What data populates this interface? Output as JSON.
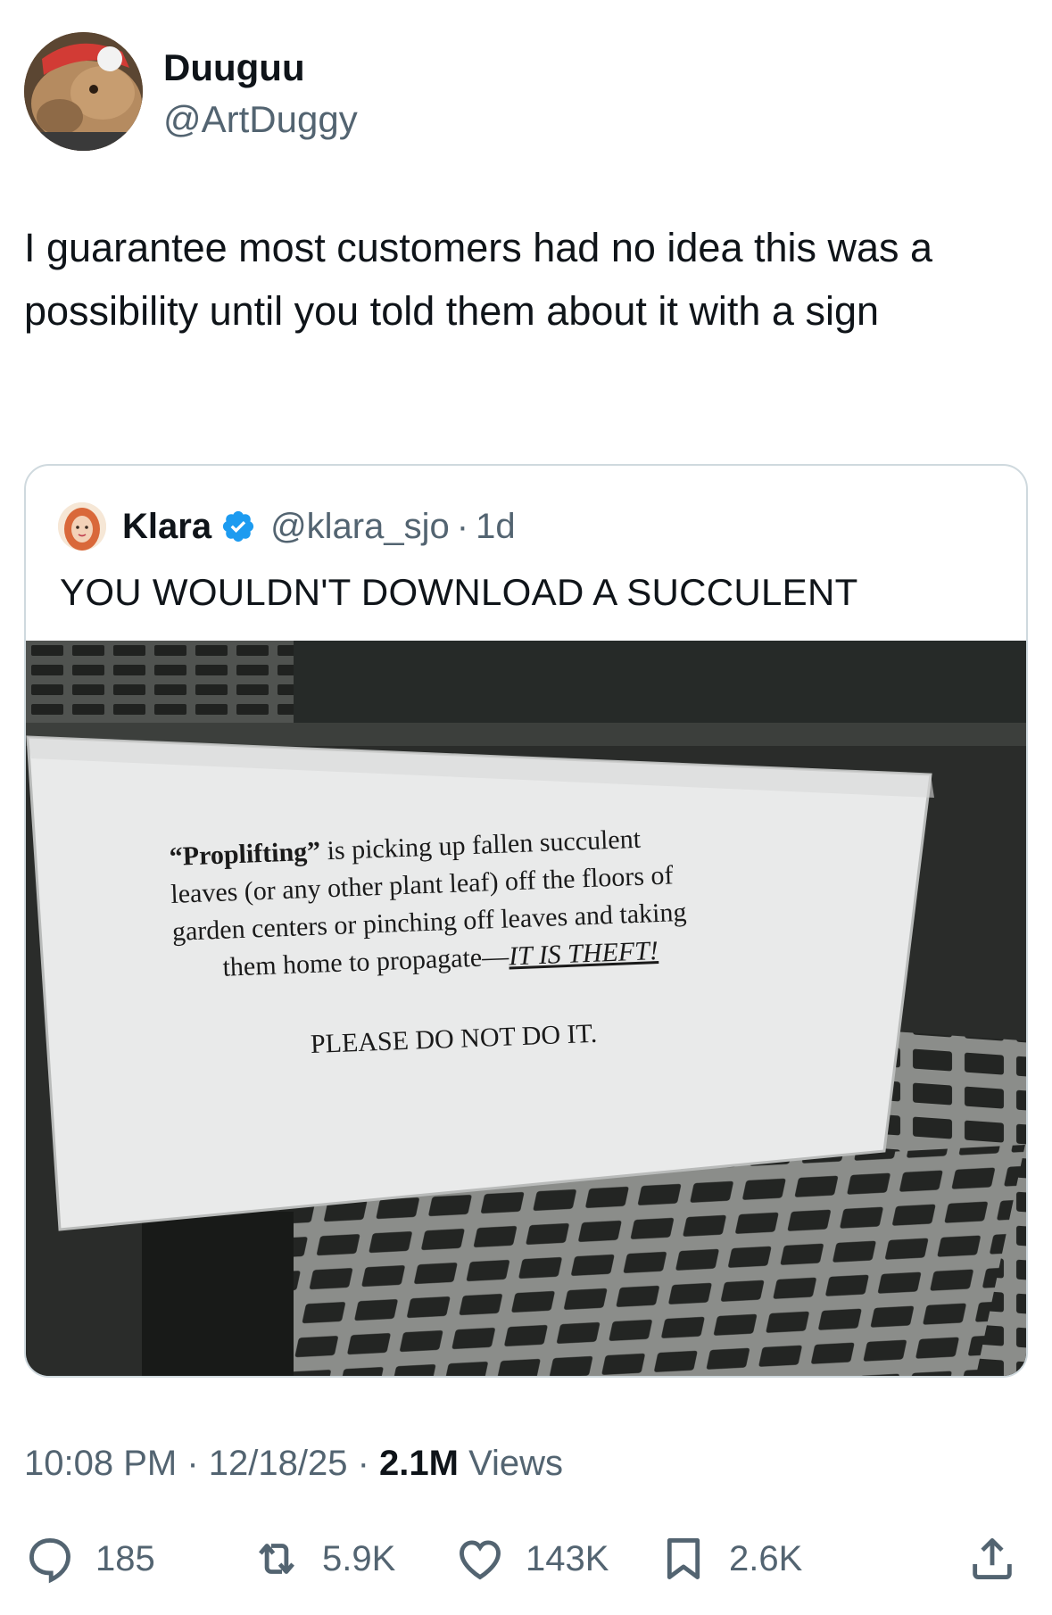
{
  "author": {
    "name": "Duuguu",
    "handle": "@ArtDuggy"
  },
  "tweet": {
    "text": "I guarantee most customers had no idea this was a possibility until you told them about it with a sign"
  },
  "quoted": {
    "name": "Klara",
    "handle": "@klara_sjo",
    "separator": "·",
    "age": "1d",
    "text": "YOU WOULDN'T DOWNLOAD A SUCCULENT",
    "sign": {
      "line1_bold": "“Proplifting”",
      "line1_rest": " is picking up fallen succulent",
      "line2": "leaves (or any other plant leaf) off the floors of",
      "line3": "garden centers or pinching off leaves and taking",
      "line4_start": "them home to propagate—",
      "line4_underlined": "IT IS THEFT!",
      "line5": "PLEASE DO NOT DO IT."
    }
  },
  "meta": {
    "time": "10:08 PM",
    "sep1": " · ",
    "date": "12/18/25",
    "sep2": " · ",
    "views_count": "2.1M",
    "views_label": " Views"
  },
  "actions": {
    "replies": "185",
    "reposts": "5.9K",
    "likes": "143K",
    "bookmarks": "2.6K"
  },
  "colors": {
    "text_primary": "#0f1419",
    "text_secondary": "#536471",
    "border": "#cfd9de",
    "verified_blue": "#1d9bf0"
  }
}
